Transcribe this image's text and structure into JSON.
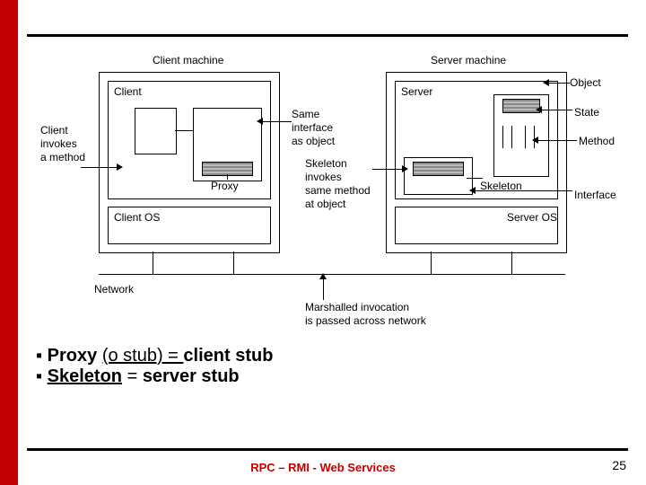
{
  "diagram": {
    "client_machine": "Client machine",
    "server_machine": "Server machine",
    "client": "Client",
    "server": "Server",
    "client_invokes": "Client\ninvokes\na method",
    "same_interface": "Same\ninterface\nas object",
    "object": "Object",
    "state": "State",
    "method": "Method",
    "interface": "Interface",
    "proxy": "Proxy",
    "skeleton": "Skeleton",
    "skeleton_invokes": "Skeleton\ninvokes\nsame method\nat object",
    "client_os": "Client OS",
    "server_os": "Server OS",
    "network": "Network",
    "marshalled": "Marshalled invocation\nis passed across network"
  },
  "bullets": {
    "b1_bold": "Proxy ",
    "b1_rest": "(o stub) = ",
    "b1_bold2": "client stub",
    "b2_bold": "Skeleton",
    "b2_rest": " = ",
    "b2_bold2": "server stub"
  },
  "footer": "RPC – RMI - Web Services",
  "pagenum": "25"
}
